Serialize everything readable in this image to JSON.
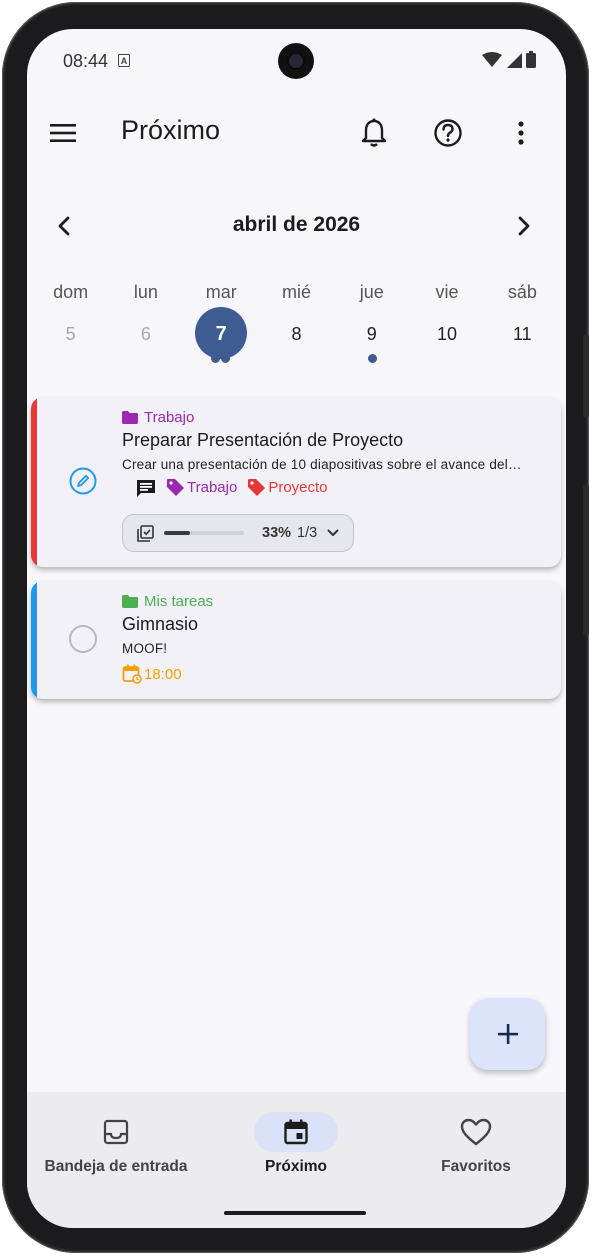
{
  "status_bar": {
    "time": "08:44",
    "notification_letter": "A"
  },
  "app_bar": {
    "title": "Próximo"
  },
  "calendar": {
    "month_title": "abril de 2026",
    "weekdays": [
      "dom",
      "lun",
      "mar",
      "mié",
      "jue",
      "vie",
      "sáb"
    ],
    "days": [
      "5",
      "6",
      "7",
      "8",
      "9",
      "10",
      "11"
    ],
    "selected_day": "7",
    "accent_color": "#3e5c91"
  },
  "tasks": [
    {
      "project": "Trabajo",
      "project_color": "#9c27b0",
      "stripe_color": "#e53935",
      "title": "Preparar Presentación de Proyecto",
      "description": "Crear una presentación de 10 diapositivas sobre el avance del proyecto",
      "tags": [
        {
          "label": "Trabajo",
          "color": "#9c27b0"
        },
        {
          "label": "Proyecto",
          "color": "#e53935"
        }
      ],
      "subtasks": {
        "percent_label": "33%",
        "count_label": "1/3",
        "progress": 0.33
      }
    },
    {
      "project": "Mis tareas",
      "project_color": "#4caf50",
      "stripe_color": "#2196f3",
      "title": "Gimnasio",
      "description": "MOOF!",
      "time": "18:00",
      "time_color": "#f59e0b"
    }
  ],
  "fab": {
    "label": "+"
  },
  "nav": {
    "items": [
      {
        "label": "Bandeja de entrada",
        "icon": "inbox-icon"
      },
      {
        "label": "Próximo",
        "icon": "calendar-icon"
      },
      {
        "label": "Favoritos",
        "icon": "heart-icon"
      }
    ]
  }
}
